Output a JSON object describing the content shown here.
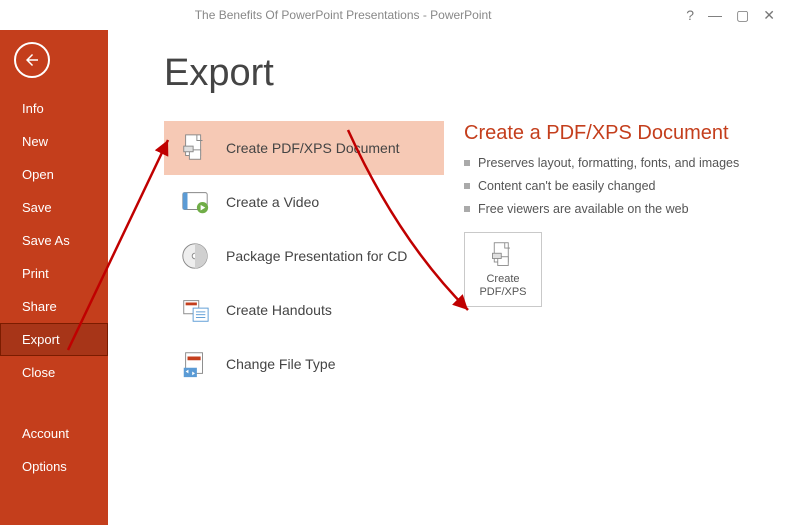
{
  "titlebar": {
    "title": "The Benefits Of PowerPoint Presentations - PowerPoint"
  },
  "sidebar": {
    "items": [
      {
        "label": "Info"
      },
      {
        "label": "New"
      },
      {
        "label": "Open"
      },
      {
        "label": "Save"
      },
      {
        "label": "Save As"
      },
      {
        "label": "Print"
      },
      {
        "label": "Share"
      },
      {
        "label": "Export"
      },
      {
        "label": "Close"
      }
    ],
    "footer": [
      {
        "label": "Account"
      },
      {
        "label": "Options"
      }
    ]
  },
  "page": {
    "heading": "Export",
    "options": [
      {
        "label": "Create PDF/XPS Document"
      },
      {
        "label": "Create a Video"
      },
      {
        "label": "Package Presentation for CD"
      },
      {
        "label": "Create Handouts"
      },
      {
        "label": "Change File Type"
      }
    ],
    "detail": {
      "title": "Create a PDF/XPS Document",
      "bullets": [
        "Preserves layout, formatting, fonts, and images",
        "Content can't be easily changed",
        "Free viewers are available on the web"
      ],
      "button_line1": "Create",
      "button_line2": "PDF/XPS"
    }
  }
}
